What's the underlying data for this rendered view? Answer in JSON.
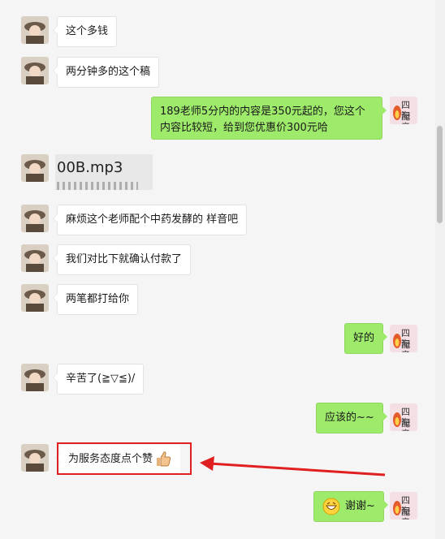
{
  "messages": [
    {
      "side": "left",
      "text": "这个多钱"
    },
    {
      "side": "left",
      "text": "两分钟多的这个稿"
    },
    {
      "side": "right",
      "line1": "189老师5分内的内容是350元起的，您这个",
      "line2": "内容比较短，给到您优惠价300元哈"
    },
    {
      "side": "left",
      "type": "file",
      "text": "00B.mp3"
    },
    {
      "side": "left",
      "text": "麻烦这个老师配个中药发酵的 样音吧"
    },
    {
      "side": "left",
      "text": "我们对比下就确认付款了"
    },
    {
      "side": "left",
      "text": "两笔都打给你"
    },
    {
      "side": "right",
      "text": "好的"
    },
    {
      "side": "left",
      "text": "辛苦了(≧▽≦)/"
    },
    {
      "side": "right",
      "text": "应该的~~"
    },
    {
      "side": "left",
      "text": "为服务态度点个赞",
      "emoji": "thumbs-up-icon",
      "highlighted": true
    },
    {
      "side": "right",
      "text": "谢谢~",
      "emoji": "grin-icon"
    }
  ],
  "sender_avatar_label": "四海配音",
  "sender_avatar_line1": "四海",
  "sender_avatar_line2": "配音",
  "colors": {
    "bubble_self": "#9eea6a",
    "bubble_other": "#ffffff",
    "highlight": "#e02020",
    "background": "#f5f5f5"
  }
}
